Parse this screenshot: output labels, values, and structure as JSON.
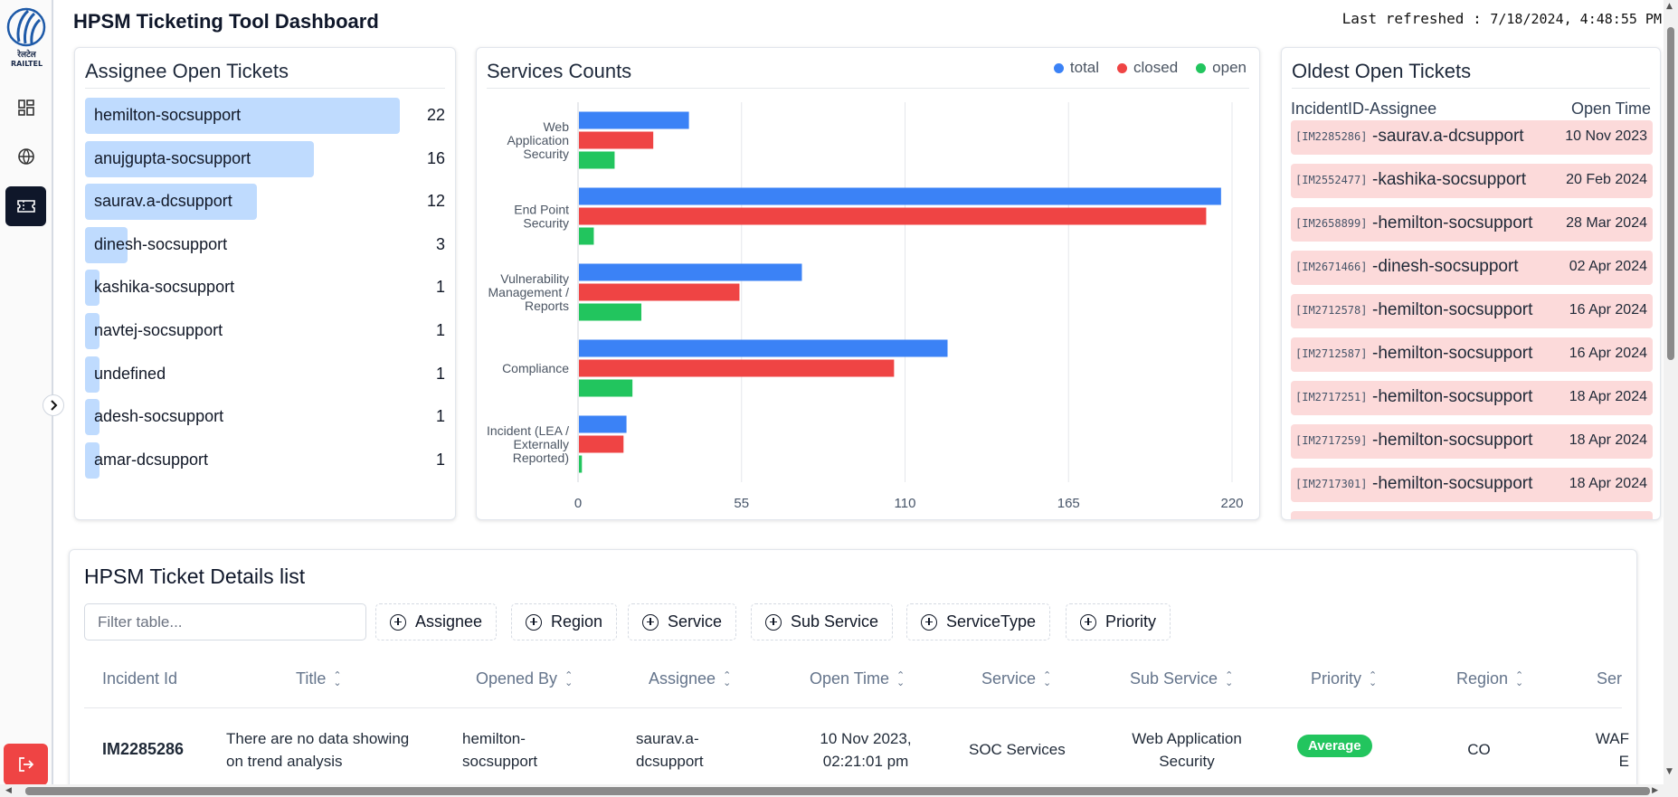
{
  "header": {
    "title": "HPSM Ticketing Tool Dashboard",
    "last_refreshed_label": "Last refreshed :",
    "last_refreshed_value": "7/18/2024, 4:48:55 PM"
  },
  "sidebar": {
    "logo_text": "रेलटेल",
    "logo_sub": "RAILTEL",
    "items": [
      {
        "icon": "dashboard-icon",
        "active": false
      },
      {
        "icon": "globe-icon",
        "active": false
      },
      {
        "icon": "ticket-icon",
        "active": true
      }
    ],
    "expand_icon": "chevron-right-icon",
    "logout_icon": "logout-icon"
  },
  "assignee_card": {
    "title": "Assignee Open Tickets",
    "max": 22,
    "rows": [
      {
        "name": "hemilton-socsupport",
        "count": 22
      },
      {
        "name": "anujgupta-socsupport",
        "count": 16
      },
      {
        "name": "saurav.a-dcsupport",
        "count": 12
      },
      {
        "name": "dinesh-socsupport",
        "count": 3
      },
      {
        "name": "kashika-socsupport",
        "count": 1
      },
      {
        "name": "navtej-socsupport",
        "count": 1
      },
      {
        "name": "undefined",
        "count": 1
      },
      {
        "name": "adesh-socsupport",
        "count": 1
      },
      {
        "name": "amar-dcsupport",
        "count": 1
      }
    ]
  },
  "services_card": {
    "title": "Services Counts",
    "legend": [
      {
        "label": "total",
        "color": "#3b82f6"
      },
      {
        "label": "closed",
        "color": "#ef4444"
      },
      {
        "label": "open",
        "color": "#22c55e"
      }
    ]
  },
  "chart_data": {
    "type": "bar",
    "orientation": "horizontal",
    "title": "Services Counts",
    "categories": [
      [
        "Web",
        "Application",
        "Security"
      ],
      [
        "End Point",
        "Security"
      ],
      [
        "Vulnerability",
        "Management /",
        "Reports"
      ],
      [
        "Compliance"
      ],
      [
        "Incident (LEA /",
        "Externally",
        "Reported)"
      ]
    ],
    "series": [
      {
        "name": "total",
        "color": "#3b82f6",
        "values": [
          37,
          216,
          75,
          124,
          16
        ]
      },
      {
        "name": "closed",
        "color": "#ef4444",
        "values": [
          25,
          211,
          54,
          106,
          15
        ]
      },
      {
        "name": "open",
        "color": "#22c55e",
        "values": [
          12,
          5,
          21,
          18,
          1
        ]
      }
    ],
    "xlim": [
      0,
      220
    ],
    "xticks": [
      "0",
      "55",
      "110",
      "165",
      "220"
    ],
    "grid": true,
    "legend_position": "top-right"
  },
  "oldest_card": {
    "title": "Oldest Open Tickets",
    "col_left": "IncidentID-Assignee",
    "col_right": "Open Time",
    "rows": [
      {
        "id": "[IM2285286]",
        "assignee": "-saurav.a-dcsupport",
        "date": "10 Nov 2023"
      },
      {
        "id": "[IM2552477]",
        "assignee": "-kashika-socsupport",
        "date": "20 Feb 2024"
      },
      {
        "id": "[IM2658899]",
        "assignee": "-hemilton-socsupport",
        "date": "28 Mar 2024"
      },
      {
        "id": "[IM2671466]",
        "assignee": "-dinesh-socsupport",
        "date": "02 Apr 2024"
      },
      {
        "id": "[IM2712578]",
        "assignee": "-hemilton-socsupport",
        "date": "16 Apr 2024"
      },
      {
        "id": "[IM2712587]",
        "assignee": "-hemilton-socsupport",
        "date": "16 Apr 2024"
      },
      {
        "id": "[IM2717251]",
        "assignee": "-hemilton-socsupport",
        "date": "18 Apr 2024"
      },
      {
        "id": "[IM2717259]",
        "assignee": "-hemilton-socsupport",
        "date": "18 Apr 2024"
      },
      {
        "id": "[IM2717301]",
        "assignee": "-hemilton-socsupport",
        "date": "18 Apr 2024"
      }
    ]
  },
  "details": {
    "title": "HPSM Ticket Details list",
    "filter_placeholder": "Filter table...",
    "filters": [
      "Assignee",
      "Region",
      "Service",
      "Sub Service",
      "ServiceType",
      "Priority"
    ],
    "columns": [
      "Incident Id",
      "Title",
      "Opened By",
      "Assignee",
      "Open Time",
      "Service",
      "Sub Service",
      "Priority",
      "Region",
      "Ser"
    ],
    "row": {
      "incident_id": "IM2285286",
      "title_line1": "There are no data showing",
      "title_line2": "on trend analysis",
      "opened_by_line1": "hemilton-",
      "opened_by_line2": "socsupport",
      "assignee_line1": "saurav.a-",
      "assignee_line2": "dcsupport",
      "open_time_line1": "10 Nov 2023,",
      "open_time_line2": "02:21:01 pm",
      "service": "SOC Services",
      "sub_service_line1": "Web Application",
      "sub_service_line2": "Security",
      "priority": "Average",
      "region": "CO",
      "service_type_line1": "WAF",
      "service_type_line2": "E"
    }
  }
}
